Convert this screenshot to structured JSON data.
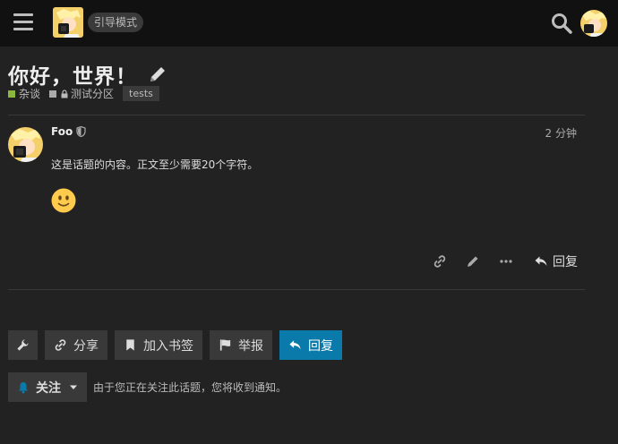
{
  "header": {
    "mode_badge": "引导模式",
    "icons": {
      "menu": "hamburger-menu-icon",
      "search": "search-icon"
    }
  },
  "topic": {
    "title": "你好，世界！",
    "category": {
      "label": "杂谈",
      "color": "#8cb83d"
    },
    "subcategory": {
      "label": "测试分区",
      "color": "#aaaaaa"
    },
    "tag": "tests"
  },
  "post": {
    "username": "Foo",
    "time": "2 分钟",
    "body": "这是话题的内容。正文至少需要20个字符。",
    "reply_label": "回复"
  },
  "footer_buttons": {
    "share": "分享",
    "bookmark": "加入书签",
    "flag": "举报",
    "reply": "回复"
  },
  "notifications": {
    "level": "关注",
    "description": "由于您正在关注此话题，您将收到通知。"
  },
  "colors": {
    "accent": "#0a7aab",
    "header_bg": "#111111",
    "page_bg": "#222222"
  }
}
